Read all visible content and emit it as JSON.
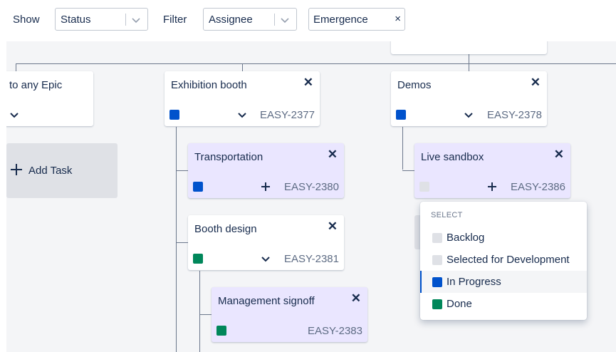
{
  "toolbar": {
    "show_label": "Show",
    "show_value": "Status",
    "filter_label": "Filter",
    "filter_value": "Assignee",
    "chip_value": "Emergence",
    "chip_close": "×"
  },
  "colors": {
    "blue": "#0052cc",
    "green": "#00875a",
    "grey": "#dfe1e6",
    "subtask_bg": "#eae6ff"
  },
  "cards": {
    "epic_left": {
      "title": "to any Epic"
    },
    "exhibition": {
      "title": "Exhibition booth",
      "key": "EASY-2377",
      "close": "✕"
    },
    "demos": {
      "title": "Demos",
      "key": "EASY-2378",
      "close": "✕"
    },
    "transportation": {
      "title": "Transportation",
      "key": "EASY-2380",
      "close": "✕"
    },
    "booth_design": {
      "title": "Booth design",
      "key": "EASY-2381",
      "close": "✕"
    },
    "mgmt_signoff": {
      "title": "Management signoff",
      "key": "EASY-2383",
      "close": "✕"
    },
    "live_sandbox": {
      "title": "Live sandbox",
      "key": "EASY-2386",
      "close": "✕"
    }
  },
  "add_task": {
    "label": "Add Task"
  },
  "status_dropdown": {
    "header": "SELECT",
    "options": [
      {
        "label": "Backlog",
        "color": "#dfe1e6"
      },
      {
        "label": "Selected for Development",
        "color": "#dfe1e6"
      },
      {
        "label": "In Progress",
        "color": "#0052cc"
      },
      {
        "label": "Done",
        "color": "#00875a"
      }
    ],
    "highlighted": "In Progress"
  }
}
